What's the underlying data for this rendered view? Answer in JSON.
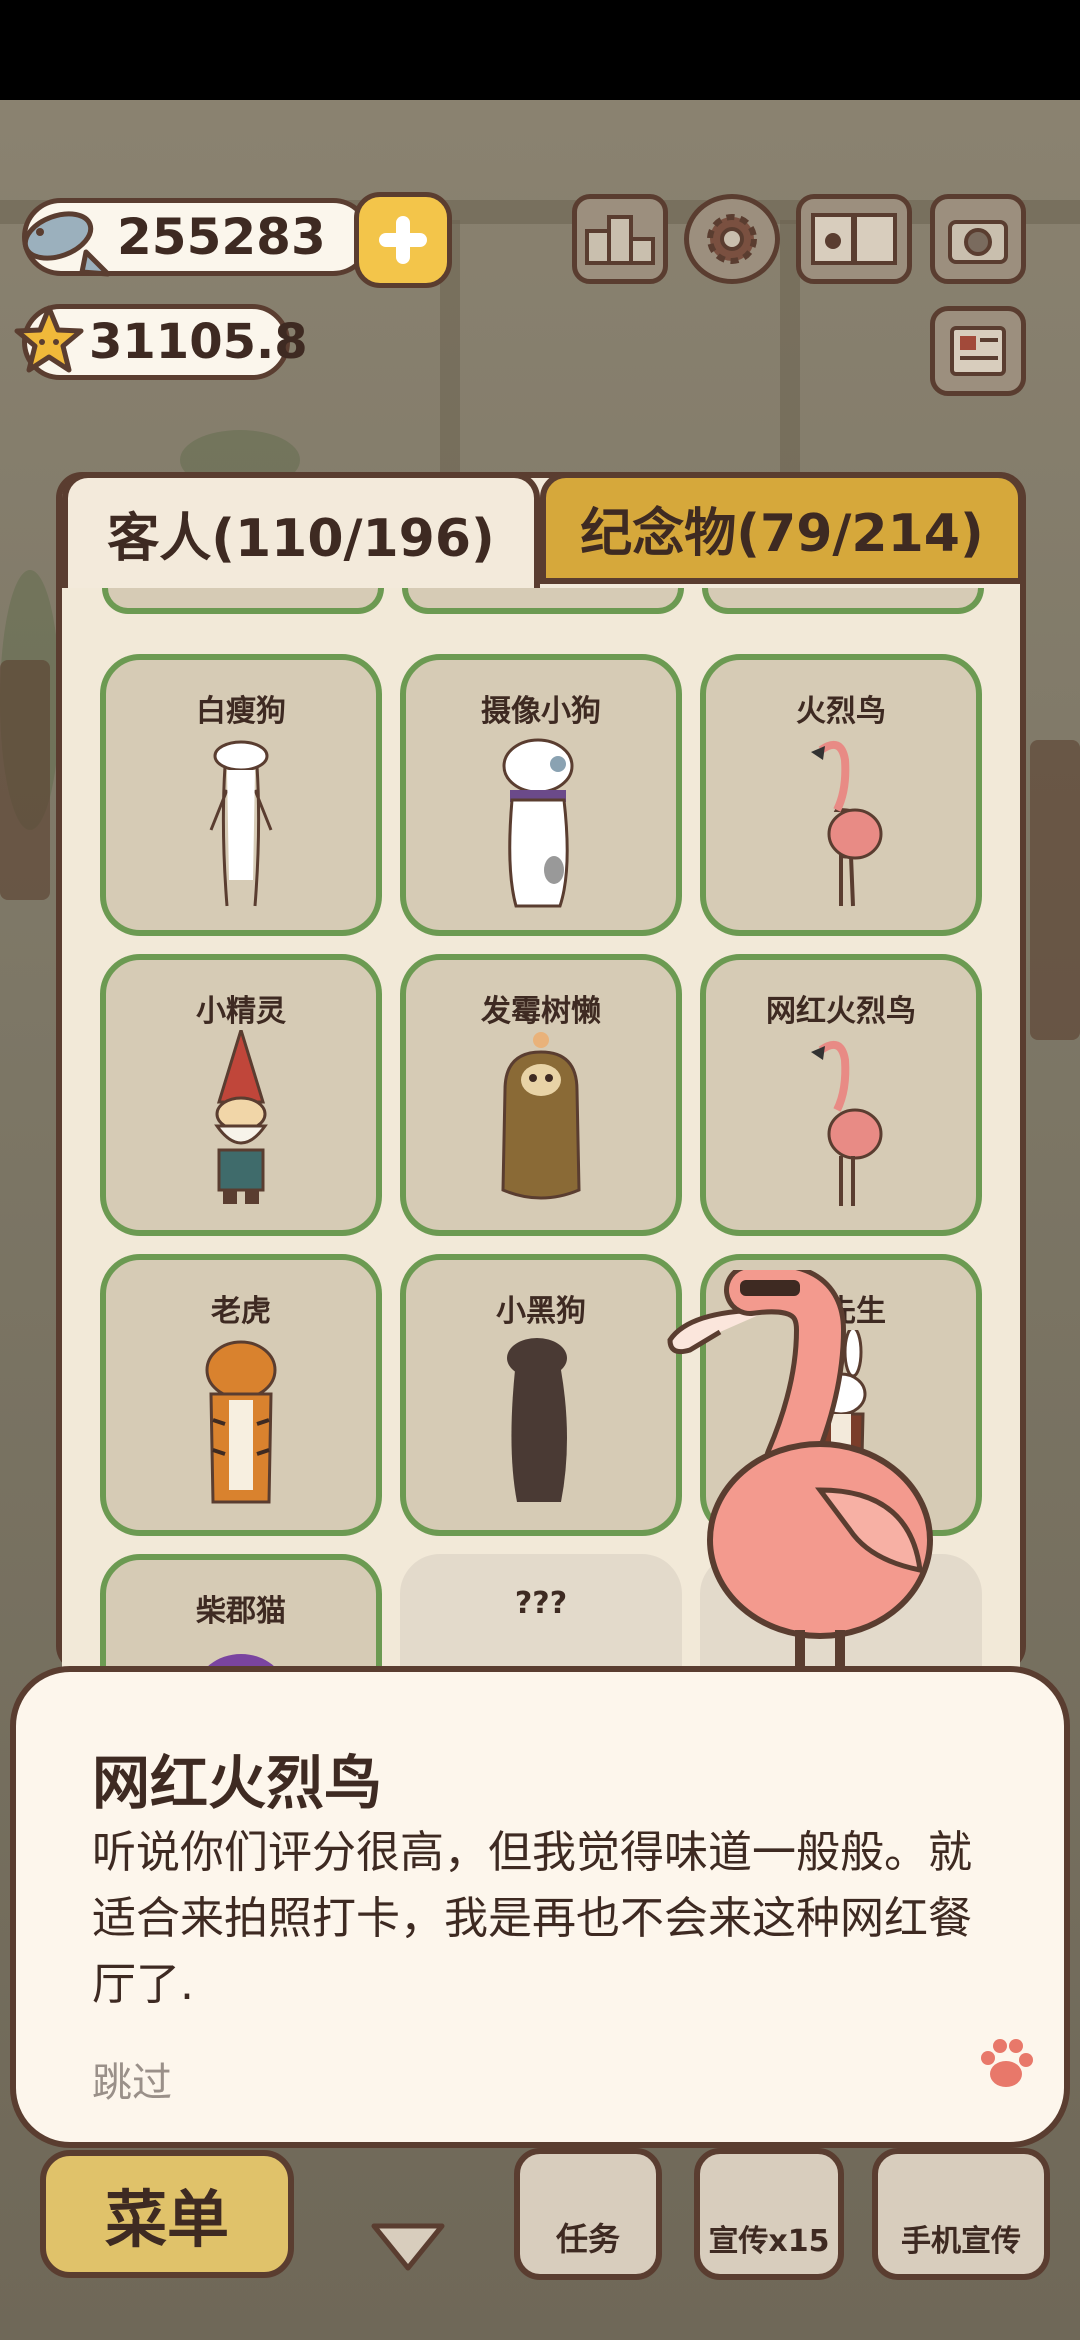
{
  "currency": {
    "fish": "255283",
    "stars": "31105.8"
  },
  "top_icons": [
    "ranking-icon",
    "gear-icon",
    "paw-book-icon",
    "camera-icon",
    "newspaper-icon"
  ],
  "tabs": {
    "guests": "客人(110/196)",
    "souvenirs": "纪念物(79/214)"
  },
  "grid": {
    "rows": [
      [
        {
          "name": "白瘦狗",
          "icon": "white-dog-icon"
        },
        {
          "name": "摄像小狗",
          "icon": "camera-dog-icon"
        },
        {
          "name": "火烈鸟",
          "icon": "flamingo-icon"
        }
      ],
      [
        {
          "name": "小精灵",
          "icon": "gnome-icon"
        },
        {
          "name": "发霉树懒",
          "icon": "sloth-icon"
        },
        {
          "name": "网红火烈鸟",
          "icon": "flamingo-icon"
        }
      ],
      [
        {
          "name": "老虎",
          "icon": "tiger-icon"
        },
        {
          "name": "小黑狗",
          "icon": "black-dog-icon"
        },
        {
          "name": "兔先生",
          "icon": "rabbit-icon"
        }
      ],
      [
        {
          "name": "柴郡猫",
          "icon": "cheshire-cat-icon"
        },
        {
          "name": "???",
          "icon": "unknown-silhouette-icon"
        },
        {
          "name": "",
          "icon": "unknown-silhouette-icon"
        }
      ]
    ]
  },
  "dialog": {
    "speaker": "网红火烈鸟",
    "text": "听说你们评分很高，但我觉得味道一般般。就适合来拍照打卡，我是再也不会来这种网红餐厅了.",
    "skip": "跳过"
  },
  "bottom": {
    "menu": "菜单",
    "tasks": "任务",
    "promo": "宣传x15",
    "phone_promo": "手机宣传"
  },
  "colors": {
    "card_border": "#6c9a52",
    "tab_inactive": "#d6a83b",
    "panel_bg": "#f3eadb",
    "outline": "#5a3d30"
  }
}
